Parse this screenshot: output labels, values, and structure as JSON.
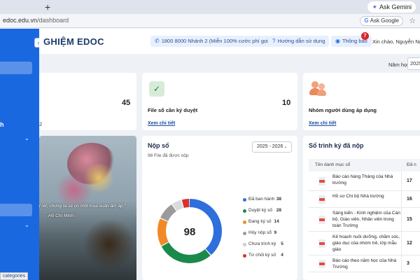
{
  "browser": {
    "tab_plus": "+",
    "ask_gemini": "Ask Gemini",
    "url_host": "edoc.edu.vn",
    "url_path": "/dashboard",
    "ask_google": "Ask Google"
  },
  "sidebar": {
    "letter": "h",
    "status_text": "categories"
  },
  "header": {
    "brand": "GHIỆM EDOC",
    "hotline": "1800 8000 Nhánh 2 (Miễn 100% cước phí gọi đến)",
    "guide": "Hướng dẫn sử dụng",
    "notify": "Thông báo",
    "notify_count": "7",
    "greeting": "Xin chào, Nguyễn Ngọc"
  },
  "year_filter": {
    "label": "Năm học",
    "value": "2025"
  },
  "stats": [
    {
      "number": "45",
      "sub": "2",
      "label": "",
      "link": ""
    },
    {
      "number": "10",
      "label": "File số cần ký duyệt",
      "link": "Xem chi tiết"
    },
    {
      "number": "",
      "label": "Nhóm người dùng áp dụng",
      "link": "Xem chi tiết"
    }
  ],
  "quote": {
    "text": "l rét, chúng ta sẽ có một mùa xuân ấm áp.\"",
    "author": "- Hồ Chí Minh -"
  },
  "nop_so": {
    "title": "Nộp sổ",
    "subtitle": "98 File đã được nộp",
    "year": "2025 - 2026",
    "total": "98"
  },
  "chart_data": {
    "type": "pie",
    "title": "Nộp sổ",
    "total": 98,
    "categories": [
      "Đã ban hành",
      "Duyệt ký số",
      "Đang ký số",
      "Hủy nộp sổ",
      "Chưa trình ký",
      "Từ chối ký số"
    ],
    "values": [
      38,
      28,
      14,
      9,
      5,
      4
    ],
    "colors": [
      "#2e6fdc",
      "#1a8a4a",
      "#ef8a26",
      "#9b9b9b",
      "#dadada",
      "#d8322c"
    ]
  },
  "so_trinh_ky": {
    "title": "Sổ trình ký đã nộp",
    "col_name": "Tên danh mục sổ",
    "col_count": "Đã n",
    "rows": [
      {
        "name": "Báo cáo hàng Tháng của Nhà trường",
        "count": "17"
      },
      {
        "name": "Hồ sơ Chi bộ Nhà trường",
        "count": "16"
      },
      {
        "name": "Sáng kiến - Kinh nghiệm của Cán bộ, Giáo viên, Nhân viên trong toàn Trường",
        "count": "15"
      },
      {
        "name": "Kế hoạch nuôi dưỡng, chăm sóc, giáo dục của nhóm trẻ, lớp mẫu giáo",
        "count": "12"
      },
      {
        "name": "Báo cáo theo năm học của Nhà Trường",
        "count": "3"
      }
    ]
  }
}
